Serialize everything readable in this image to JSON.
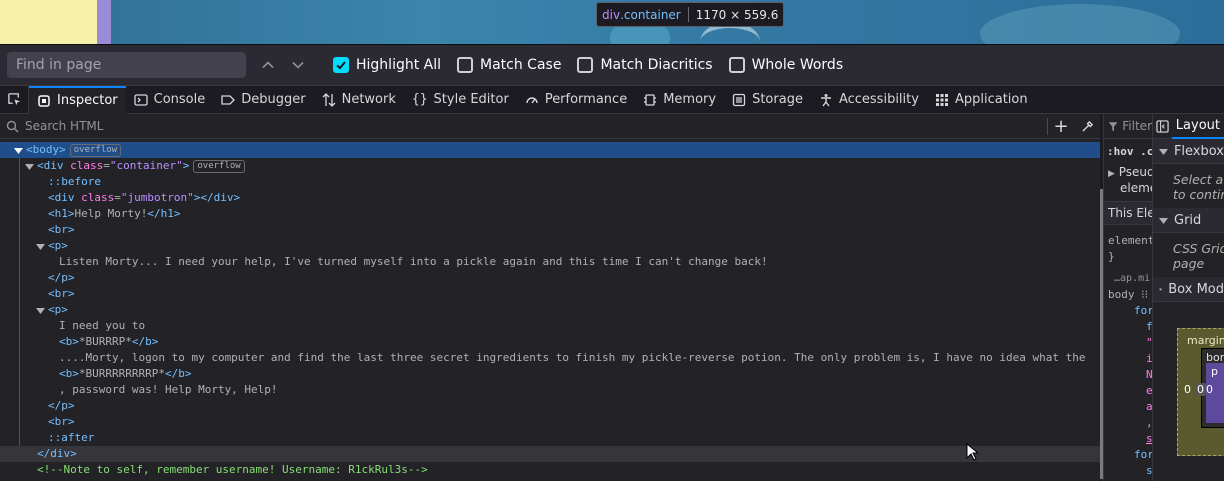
{
  "page": {
    "tooltip": {
      "tag": "div",
      "class": ".container",
      "size": "1170 × 559.6"
    }
  },
  "findbar": {
    "placeholder": "Find in page",
    "options": [
      {
        "label": "Highlight All",
        "checked": true
      },
      {
        "label": "Match Case",
        "checked": false
      },
      {
        "label": "Match Diacritics",
        "checked": false
      },
      {
        "label": "Whole Words",
        "checked": false
      }
    ]
  },
  "devtools": {
    "tabs": [
      "Inspector",
      "Console",
      "Debugger",
      "Network",
      "Style Editor",
      "Performance",
      "Memory",
      "Storage",
      "Accessibility",
      "Application"
    ],
    "selected_tab": "Inspector",
    "search_placeholder": "Search HTML"
  },
  "markup": {
    "body_tag": "<body>",
    "badge": "overflow",
    "div_open_tag": "<div",
    "div_attr": "class",
    "div_attr_val": "\"container\"",
    "div_open_close": ">",
    "before": "::before",
    "jumbo_open": "<div",
    "jumbo_attr": "class",
    "jumbo_val": "\"jumbotron\"",
    "jumbo_end": "></div>",
    "h1_open": "<h1>",
    "h1_text": "Help Morty!",
    "h1_close": "</h1>",
    "br": "<br>",
    "p_open": "<p>",
    "p1_text": "Listen Morty... I need your help, I've turned myself into a pickle again and this time I can't change back!",
    "p_close": "</p>",
    "p2_text1": "I need you to",
    "b_open": "<b>",
    "b_close": "</b>",
    "b1_text": "*BURRRP*",
    "p2_text2": "....Morty, logon to my computer and find the last three secret ingredients to finish my pickle-reverse potion. The only problem is, I have no idea what the",
    "b2_text": "*BURRRRRRRRP*",
    "p2_text3": ", password was! Help Morty, Help!",
    "after": "::after",
    "div_close": "</div>",
    "comment": "<!--Note to self, remember username! Username: R1ckRul3s-->"
  },
  "rules": {
    "filter": "Filter",
    "hov": ":hov .cl",
    "pseudo1": "Pseud",
    "pseudo2": "eleme",
    "this_element": "This Ele",
    "element": "element",
    "brace": "}",
    "source": "…ap.mi",
    "body_sel": "body",
    "l1": "for",
    "l2": "f",
    "l3": "\"",
    "l4": "i",
    "l5": "N",
    "l6": "e",
    "l7": "a",
    "l8": ",",
    "l9": "s",
    "l10": "for",
    "l11": "s"
  },
  "layout_pane": {
    "tab": "Layout",
    "flexbox": "Flexbox",
    "flexbox_hint1": "Select a",
    "flexbox_hint2": "to contir",
    "grid": "Grid",
    "grid_hint1": "CSS Grid",
    "grid_hint2": "page",
    "boxmodel": "Box Mod",
    "margin": "margin",
    "border": "bor",
    "padding": "p",
    "v0a": "0",
    "v0b": "0",
    "v0c": "0"
  }
}
